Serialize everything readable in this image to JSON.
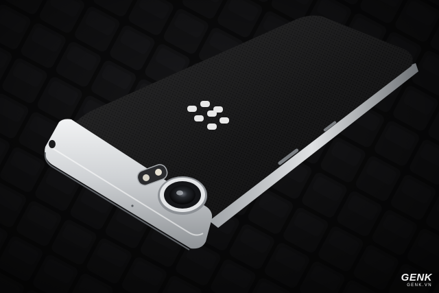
{
  "scene": {
    "subject": "smartphone-back",
    "colors": {
      "background": "#0b0b0c",
      "phone_body": "#151516",
      "metal_frame": "#c9cccf",
      "logo": "#e8e8e8"
    }
  },
  "watermark": {
    "logo_text": "GENK",
    "site_text": "GENK.VN"
  }
}
